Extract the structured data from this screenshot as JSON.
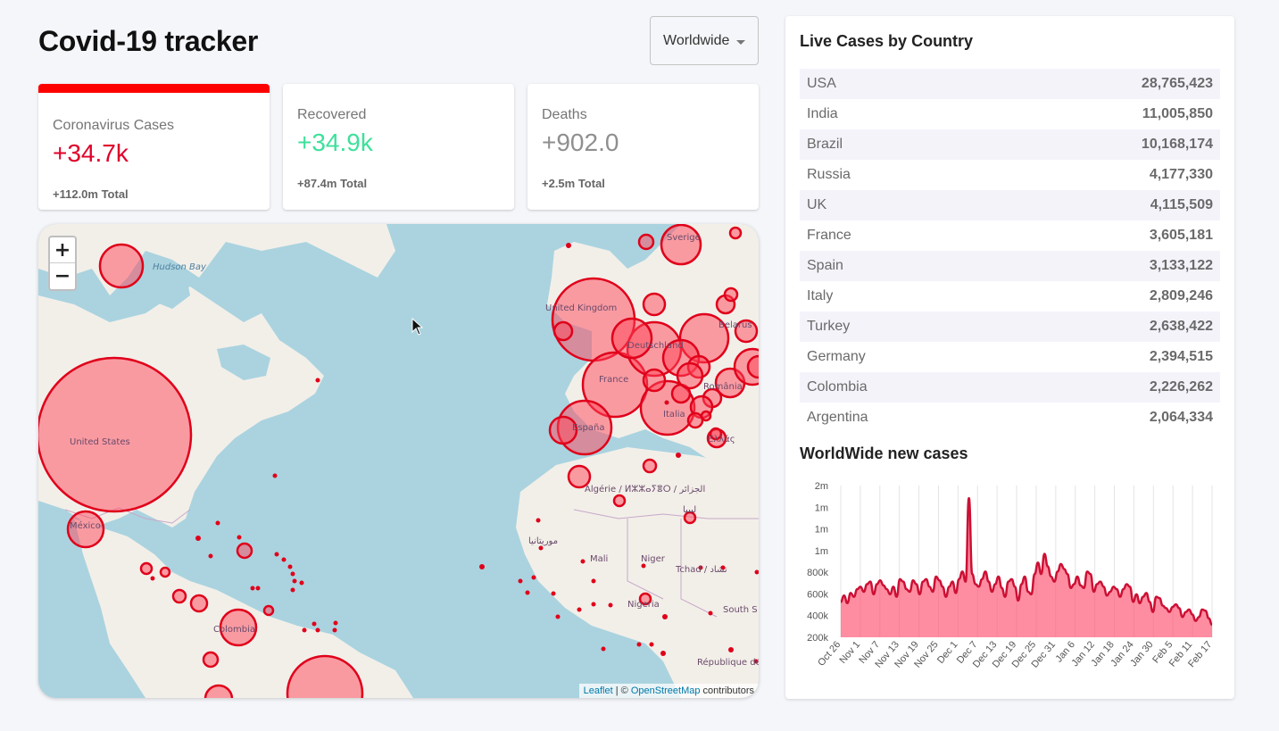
{
  "app": {
    "title": "Covid-19 tracker",
    "country_select": "Worldwide"
  },
  "stats": [
    {
      "title": "Coronavirus Cases",
      "value": "+34.7k",
      "total": "+112.0m Total",
      "color": "#e0002a"
    },
    {
      "title": "Recovered",
      "value": "+34.9k",
      "total": "+87.4m Total",
      "color": "#3fe09b"
    },
    {
      "title": "Deaths",
      "value": "+902.0",
      "total": "+2.5m Total",
      "color": "#8f8f8f"
    }
  ],
  "map": {
    "zoom_in": "+",
    "zoom_out": "−",
    "labels": [
      "Hudson Bay",
      "United States",
      "México",
      "United Kingdom",
      "Deutschland",
      "France",
      "España",
      "Italia",
      "Sverige",
      "România",
      "Ελλάς",
      "Algérie / ⵍⵣⵣⴰⵢⴻⵔ / الجزائر",
      "Mali",
      "Niger",
      "Tchad / تشاد",
      "Nigeria",
      "ليبيا",
      "موريتانيا",
      "Colombia",
      "South S",
      "République démocratique du Congo",
      "Belarus"
    ],
    "attribution": {
      "leaflet": "Leaflet",
      "sep": " | © ",
      "osm": "OpenStreetMap",
      "contributors": " contributors"
    }
  },
  "live_cases": {
    "heading": "Live Cases by Country",
    "rows": [
      {
        "country": "USA",
        "cases": "28,765,423"
      },
      {
        "country": "India",
        "cases": "11,005,850"
      },
      {
        "country": "Brazil",
        "cases": "10,168,174"
      },
      {
        "country": "Russia",
        "cases": "4,177,330"
      },
      {
        "country": "UK",
        "cases": "4,115,509"
      },
      {
        "country": "France",
        "cases": "3,605,181"
      },
      {
        "country": "Spain",
        "cases": "3,133,122"
      },
      {
        "country": "Italy",
        "cases": "2,809,246"
      },
      {
        "country": "Turkey",
        "cases": "2,638,422"
      },
      {
        "country": "Germany",
        "cases": "2,394,515"
      },
      {
        "country": "Colombia",
        "cases": "2,226,262"
      },
      {
        "country": "Argentina",
        "cases": "2,064,334"
      }
    ]
  },
  "new_cases_heading": "WorldWide new cases",
  "chart_data": {
    "type": "area",
    "title": "WorldWide new cases",
    "color": "#cc1034",
    "fill": "rgba(255,80,110,0.65)",
    "y_tick_labels": [
      "2m",
      "1m",
      "1m",
      "1m",
      "800k",
      "600k",
      "400k",
      "200k"
    ],
    "x_tick_labels": [
      "Oct 26",
      "Nov 1",
      "Nov 7",
      "Nov 13",
      "Nov 19",
      "Nov 25",
      "Dec 1",
      "Dec 7",
      "Dec 13",
      "Dec 19",
      "Dec 25",
      "Dec 31",
      "Jan 6",
      "Jan 12",
      "Jan 18",
      "Jan 24",
      "Jan 30",
      "Feb 5",
      "Feb 11",
      "Feb 17"
    ],
    "ylim": [
      200000,
      1400000
    ],
    "grid": "vertical",
    "values": [
      480000,
      530000,
      470000,
      550000,
      520000,
      580000,
      600000,
      560000,
      620000,
      640000,
      540000,
      620000,
      650000,
      610000,
      580000,
      540000,
      600000,
      520000,
      660000,
      640000,
      580000,
      560000,
      650000,
      620000,
      540000,
      640000,
      660000,
      600000,
      560000,
      680000,
      650000,
      600000,
      520000,
      600000,
      640000,
      550000,
      660000,
      720000,
      640000,
      1300000,
      700000,
      620000,
      600000,
      660000,
      720000,
      640000,
      560000,
      620000,
      680000,
      590000,
      520000,
      640000,
      660000,
      600000,
      490000,
      620000,
      680000,
      560000,
      540000,
      700000,
      790000,
      700000,
      860000,
      760000,
      680000,
      640000,
      720000,
      780000,
      740000,
      700000,
      590000,
      620000,
      680000,
      610000,
      590000,
      720000,
      700000,
      560000,
      620000,
      640000,
      600000,
      530000,
      560000,
      600000,
      580000,
      520000,
      580000,
      620000,
      600000,
      480000,
      540000,
      470000,
      520000,
      550000,
      480000,
      400000,
      520000,
      510000,
      450000,
      430000,
      400000,
      440000,
      460000,
      430000,
      360000,
      400000,
      420000,
      380000,
      330000,
      360000,
      420000,
      410000,
      350000,
      300000
    ]
  }
}
